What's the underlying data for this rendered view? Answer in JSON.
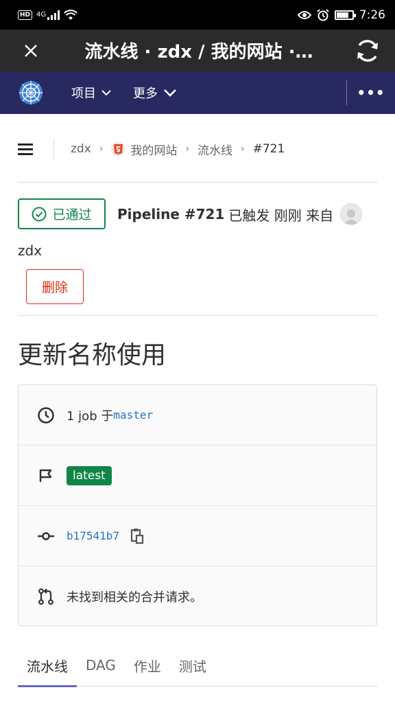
{
  "status_bar": {
    "hd": "HD",
    "network": "4G",
    "time": "7:26"
  },
  "browser": {
    "title": "流水线 · zdx / 我的网站 ·…"
  },
  "nav": {
    "projects_label": "项目",
    "more_label": "更多",
    "overflow": "•••"
  },
  "breadcrumb": {
    "items": [
      "zdx",
      "我的网站",
      "流水线",
      "#721"
    ]
  },
  "pipeline": {
    "status": "已通过",
    "id": "Pipeline #721",
    "triggered_text": "已触发 刚刚 来自",
    "user": "zdx",
    "delete_label": "删除",
    "title": "更新名称使用"
  },
  "info": {
    "jobs_text": "1 job 于",
    "branch": "master",
    "tag": "latest",
    "commit": "b17541b7",
    "mr_text": "未找到相关的合并请求。"
  },
  "tabs": [
    "流水线",
    "DAG",
    "作业",
    "测试"
  ],
  "colors": {
    "nav_bg": "#292961",
    "success": "#108548",
    "danger": "#dd2b0e",
    "link": "#1f75cb"
  }
}
